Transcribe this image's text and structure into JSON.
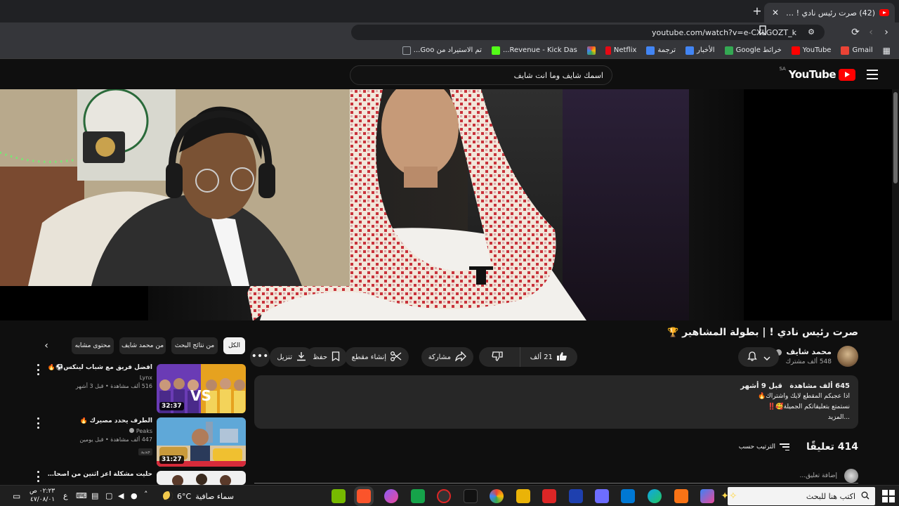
{
  "browser": {
    "tab_title": "(42) صرت رئيس نادي ! | بطولة المشاهير",
    "tab_close": "✕",
    "new_tab": "+",
    "url": "youtube.com/watch?v=e-CXLGOZT_k",
    "bookmarks": [
      {
        "label": "Gmail",
        "color": "#ea4335"
      },
      {
        "label": "YouTube",
        "color": "#ff0000"
      },
      {
        "label": "خرائط Google",
        "color": "#34a853"
      },
      {
        "label": "الأخبار",
        "color": "#4285f4"
      },
      {
        "label": "ترجمة",
        "color": "#4285f4"
      },
      {
        "label": "Netflix",
        "color": "#e50914"
      },
      {
        "label": "",
        "color": "#fbbc05"
      },
      {
        "label": "Revenue - Kick Das...",
        "color": "#53fc18"
      },
      {
        "label": "تم الاستيراد من Goo...",
        "color": "#9aa0a6"
      }
    ]
  },
  "youtube": {
    "logo_word": "YouTube",
    "region": "SA",
    "search_value": "اسمك شايف وما انت شايف"
  },
  "video": {
    "title": "صرت رئيس نادي ! | بطولة المشاهير",
    "title_emoji": "🏆",
    "channel": "محمد شايف",
    "subscribers": "548 ألف مشترك",
    "likes": "21 ألف",
    "share": "مشاركة",
    "clip": "إنشاء مقطع",
    "save": "حفظ",
    "download": "تنزيل",
    "more": "•••",
    "desc_meta_views": "645 ألف مشاهدة",
    "desc_meta_date": "قبل 9 أشهر",
    "desc_line1": "اذا عجبكم المقطع لايك واشتراك🔥",
    "desc_line2": "نستمتع بتعليقاتكم الجميلة🥰‼️",
    "desc_more": "...المزيد",
    "comments_count": "414 تعليقًا",
    "sort_label": "الترتيب حسب",
    "add_comment": "إضافة تعليق..."
  },
  "sidebar": {
    "chips": [
      "الكل",
      "من نتائج البحث",
      "من محمد شايف",
      "محتوى مشابه"
    ],
    "related": [
      {
        "title": "افضل فريق مع شباب لينكس⚽🔥",
        "channel": "Lynx",
        "views": "516 ألف مشاهدة • قبل 3 أشهر",
        "duration": "32:37",
        "badge": ""
      },
      {
        "title": "الطرف يحدد مصيرك 🔥",
        "channel": "Peaks",
        "views": "447 ألف مشاهدة • قبل يومين",
        "duration": "31:27",
        "badge": "جديد"
      },
      {
        "title": "حليت مشكلة اعز اثنين من اصحابي",
        "channel": "",
        "views": "",
        "duration": "",
        "badge": ""
      }
    ]
  },
  "taskbar": {
    "search_placeholder": "اكتب هنا للبحث",
    "weather_temp": "6°C",
    "weather_text": "سماء صافية",
    "lang": "ع",
    "time": "٠٢:٢٣ ص",
    "date": "٤٧/٠٨/٠١"
  }
}
